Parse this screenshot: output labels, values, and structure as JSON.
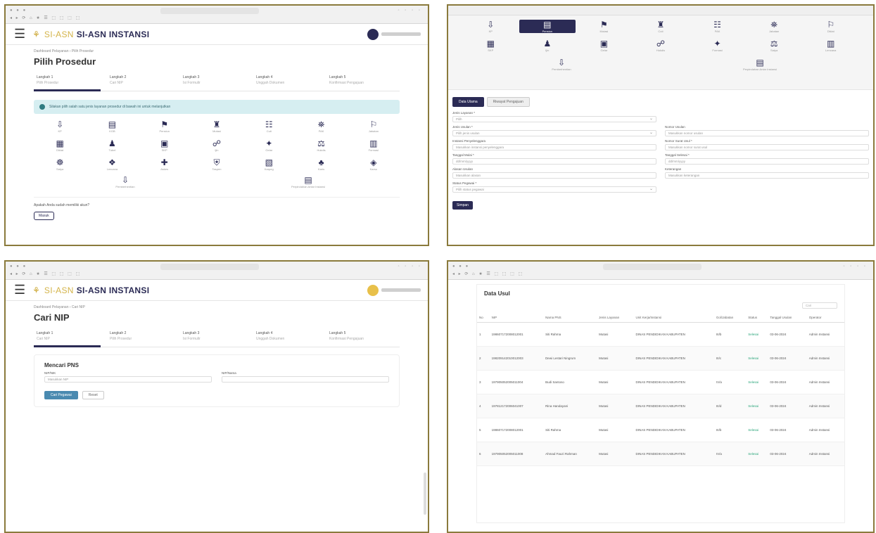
{
  "app": {
    "brand": "SI-ASN INSTANSI",
    "brand_tag": "SI-ASN"
  },
  "panel1": {
    "crumb": "Dashboard Pelayanan › Pilih Prosedur",
    "title": "Pilih Prosedur",
    "steps": [
      {
        "num": "Langkah 1",
        "name": "Pilih Prosedur"
      },
      {
        "num": "Langkah 2",
        "name": "Cari NIP"
      },
      {
        "num": "Langkah 3",
        "name": "Isi Formulir"
      },
      {
        "num": "Langkah 4",
        "name": "Unggah Dokumen"
      },
      {
        "num": "Langkah 5",
        "name": "Konfirmasi Pengajuan"
      }
    ],
    "alert": "Silakan pilih salah satu jenis layanan prosedur di bawah ini untuk melanjutkan",
    "items": [
      "KP",
      "KGB",
      "Pensiun",
      "Mutasi",
      "Cuti",
      "PAK",
      "Jabatan",
      "Diklat",
      "Tubel",
      "SKP",
      "Ijin",
      "Gelar",
      "Hukdis",
      "Formasi",
      "Satya",
      "Lencana",
      "Askes",
      "Taspen",
      "Karpeg",
      "Karis",
      "Karsu"
    ],
    "last_items": [
      "Pemberhentian",
      "Perpindahan Antar Instansi"
    ],
    "foot_q": "Apakah Anda sudah memiliki akun?",
    "foot_btn": "Masuk"
  },
  "panel2": {
    "items": [
      "KP",
      "Pensiun",
      "Mutasi",
      "Cuti",
      "PAK",
      "Jabatan",
      "Diklat",
      "SKP",
      "Ijin",
      "Gelar",
      "Hukdis",
      "Formasi",
      "Satya",
      "Lencana"
    ],
    "last_items": [
      "Pemberhentian",
      "Perpindahan Antar Instansi"
    ],
    "tabs": [
      "Data Utama",
      "Riwayat Pengajuan"
    ],
    "fields": [
      {
        "label": "Jenis Layanan *",
        "value": "Pilih",
        "select": true
      },
      {
        "label": "",
        "value": "",
        "select": false
      },
      {
        "label": "Jenis Usulan *",
        "value": "Pilih jenis usulan",
        "select": true
      },
      {
        "label": "Nomor Usulan",
        "value": "Masukkan nomor usulan",
        "select": false
      },
      {
        "label": "Instansi Penyelenggara",
        "value": "Masukkan instansi penyelenggara",
        "select": false
      },
      {
        "label": "Nomor Surat Usul *",
        "value": "Masukkan nomor surat usul",
        "select": false
      },
      {
        "label": "Tanggal Mulai *",
        "value": "dd/mm/yyyy",
        "select": false
      },
      {
        "label": "Tanggal Selesai *",
        "value": "dd/mm/yyyy",
        "select": false
      },
      {
        "label": "Alasan Usulan",
        "value": "Masukkan alasan",
        "select": false
      },
      {
        "label": "Keterangan",
        "value": "Masukkan keterangan",
        "select": false
      },
      {
        "label": "Status Pegawai *",
        "value": "Pilih status pegawai",
        "select": true
      }
    ],
    "submit": "Simpan"
  },
  "panel3": {
    "crumb": "Dashboard Pelayanan › Cari NIP",
    "title": "Cari NIP",
    "steps": [
      {
        "num": "Langkah 1",
        "name": "Cari NIP"
      },
      {
        "num": "Langkah 2",
        "name": "Pilih Prosedur"
      },
      {
        "num": "Langkah 3",
        "name": "Isi Formulir"
      },
      {
        "num": "Langkah 4",
        "name": "Unggah Dokumen"
      },
      {
        "num": "Langkah 5",
        "name": "Konfirmasi Pengajuan"
      }
    ],
    "card_title": "Mencari PNS",
    "nip_label": "NIP/NIK",
    "nip_placeholder": "Masukkan NIP",
    "name_label": "NIP/Nama",
    "btn_search": "Cari Pegawai",
    "btn_reset": "Reset"
  },
  "panel4": {
    "title": "Data Usul",
    "search": "Cari",
    "headers": [
      "No",
      "NIP",
      "Nama PNS",
      "Jenis Layanan",
      "Unit Kerja/Instansi",
      "Gol/Jabatan",
      "Status",
      "Tanggal Usulan",
      "Operator"
    ],
    "rows": [
      [
        "1",
        "198607172008012001",
        "Siti Rahma",
        "Mutasi",
        "DINAS PENDIDIKAN KABUPATEN",
        "III/b",
        "Selesai",
        "03-06-2024",
        "Admin Instansi"
      ],
      [
        "2",
        "198209142010012003",
        "Dewi Lestari Ningrum",
        "Mutasi",
        "DINAS PENDIDIKAN KABUPATEN",
        "III/c",
        "Selesai",
        "03-06-2024",
        "Admin Instansi"
      ],
      [
        "3",
        "197905052005011004",
        "Budi Santoso",
        "Mutasi",
        "DINAS PENDIDIKAN KABUPATEN",
        "IV/a",
        "Selesai",
        "03-06-2024",
        "Admin Instansi"
      ],
      [
        "4",
        "197812172006041007",
        "Rina Handayani",
        "Mutasi",
        "DINAS PENDIDIKAN KABUPATEN",
        "III/d",
        "Selesai",
        "03-06-2024",
        "Admin Instansi"
      ],
      [
        "5",
        "198607172008012001",
        "Siti Rahma",
        "Mutasi",
        "DINAS PENDIDIKAN KABUPATEN",
        "III/b",
        "Selesai",
        "03-06-2024",
        "Admin Instansi"
      ],
      [
        "6",
        "197905052005011008",
        "Ahmad Fauzi Rahman",
        "Mutasi",
        "DINAS PENDIDIKAN KABUPATEN",
        "IV/a",
        "Selesai",
        "03-06-2024",
        "Admin Instansi"
      ]
    ]
  }
}
